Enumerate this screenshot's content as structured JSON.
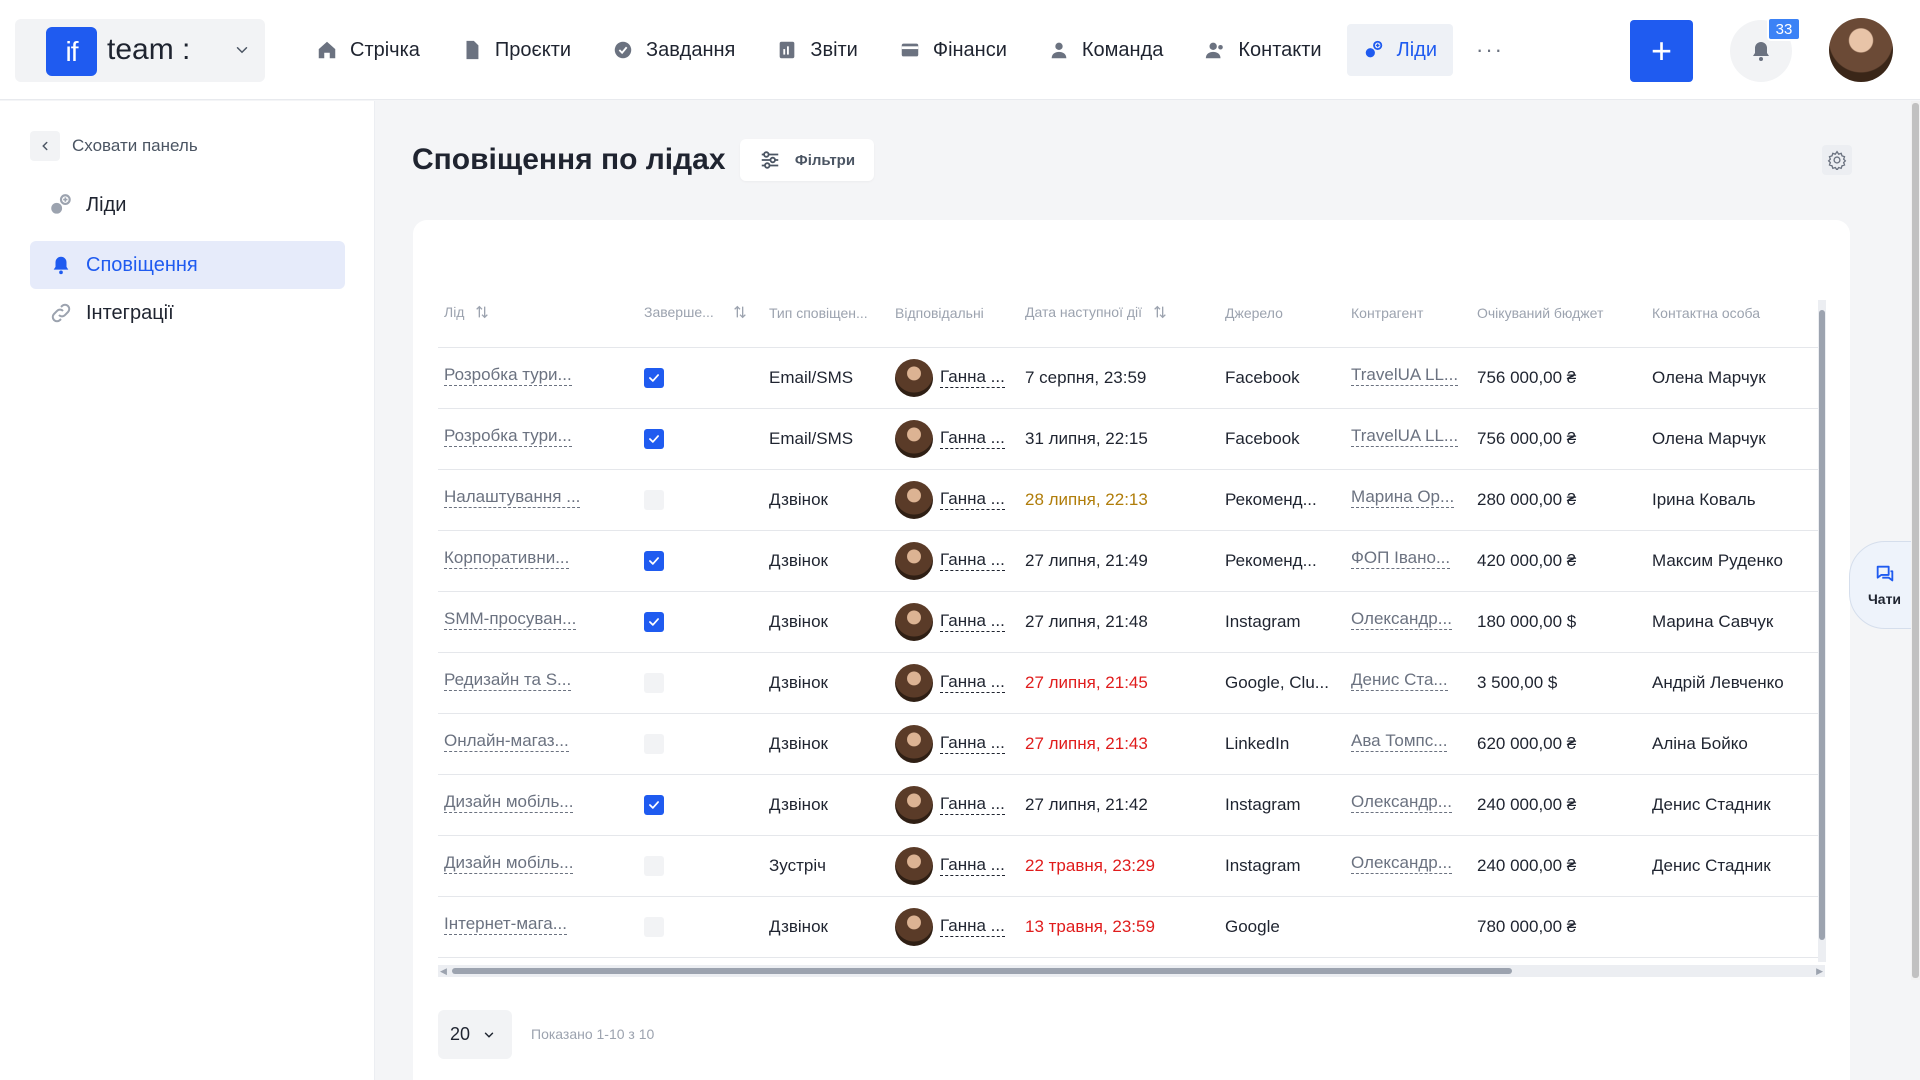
{
  "header": {
    "logo_text": "if",
    "team_name": "team :",
    "nav": [
      {
        "label": "Стрічка",
        "icon": "home-icon"
      },
      {
        "label": "Проєкти",
        "icon": "document-icon"
      },
      {
        "label": "Завдання",
        "icon": "check-circle-icon"
      },
      {
        "label": "Звіти",
        "icon": "report-icon"
      },
      {
        "label": "Фінанси",
        "icon": "wallet-icon"
      },
      {
        "label": "Команда",
        "icon": "person-icon"
      },
      {
        "label": "Контакти",
        "icon": "contacts-icon"
      },
      {
        "label": "Ліди",
        "icon": "leads-icon",
        "active": true
      }
    ],
    "more": "···",
    "add_label": "+",
    "notifications_count": "33"
  },
  "sidebar": {
    "hide_label": "Сховати панель",
    "items": [
      {
        "label": "Ліди",
        "icon": "leads-icon"
      },
      {
        "label": "Сповіщення",
        "icon": "bell-icon",
        "active": true
      },
      {
        "label": "Інтеграції",
        "icon": "link-icon"
      }
    ]
  },
  "main": {
    "title": "Сповіщення по лідах",
    "filters_label": "Фільтри"
  },
  "table": {
    "columns": [
      "Лід",
      "Заверше...",
      "Тип сповіщен...",
      "Відповідальні",
      "Дата наступної дії",
      "Джерело",
      "Контрагент",
      "Очікуваний бюджет",
      "Контактна особа"
    ],
    "rows": [
      {
        "lead": "Розробка тури...",
        "done": true,
        "type": "Email/SMS",
        "resp": "Ганна ...",
        "date": "7 серпня, 23:59",
        "date_status": "normal",
        "source": "Facebook",
        "counterparty": "TravelUA LL...",
        "budget": "756 000,00 ₴",
        "contact": "Олена Марчук"
      },
      {
        "lead": "Розробка тури...",
        "done": true,
        "type": "Email/SMS",
        "resp": "Ганна ...",
        "date": "31 липня, 22:15",
        "date_status": "normal",
        "source": "Facebook",
        "counterparty": "TravelUA LL...",
        "budget": "756 000,00 ₴",
        "contact": "Олена Марчук"
      },
      {
        "lead": "Налаштування ...",
        "done": false,
        "type": "Дзвінок",
        "resp": "Ганна ...",
        "date": "28 липня, 22:13",
        "date_status": "warn",
        "source": "Рекоменд...",
        "counterparty": "Марина Ор...",
        "budget": "280 000,00 ₴",
        "contact": "Ірина Коваль"
      },
      {
        "lead": "Корпоративни...",
        "done": true,
        "type": "Дзвінок",
        "resp": "Ганна ...",
        "date": "27 липня, 21:49",
        "date_status": "normal",
        "source": "Рекоменд...",
        "counterparty": "ФОП Івано...",
        "budget": "420 000,00 ₴",
        "contact": "Максим Руденко"
      },
      {
        "lead": "SMM-просуван...",
        "done": true,
        "type": "Дзвінок",
        "resp": "Ганна ...",
        "date": "27 липня, 21:48",
        "date_status": "normal",
        "source": "Instagram",
        "counterparty": "Олександр...",
        "budget": "180 000,00 $",
        "contact": "Марина Савчук"
      },
      {
        "lead": "Редизайн та S...",
        "done": false,
        "type": "Дзвінок",
        "resp": "Ганна ...",
        "date": "27 липня, 21:45",
        "date_status": "over",
        "source": "Google, Clu...",
        "counterparty": "Денис Ста...",
        "budget": "3 500,00 $",
        "contact": "Андрій Левченко"
      },
      {
        "lead": "Онлайн-магаз...",
        "done": false,
        "type": "Дзвінок",
        "resp": "Ганна ...",
        "date": "27 липня, 21:43",
        "date_status": "over",
        "source": "LinkedIn",
        "counterparty": "Ава Томпс...",
        "budget": "620 000,00 ₴",
        "contact": "Аліна Бойко"
      },
      {
        "lead": "Дизайн мобіль...",
        "done": true,
        "type": "Дзвінок",
        "resp": "Ганна ...",
        "date": "27 липня, 21:42",
        "date_status": "normal",
        "source": "Instagram",
        "counterparty": "Олександр...",
        "budget": "240 000,00 ₴",
        "contact": "Денис Стадник"
      },
      {
        "lead": "Дизайн мобіль...",
        "done": false,
        "type": "Зустріч",
        "resp": "Ганна ...",
        "date": "22 травня, 23:29",
        "date_status": "over",
        "source": "Instagram",
        "counterparty": "Олександр...",
        "budget": "240 000,00 ₴",
        "contact": "Денис Стадник"
      },
      {
        "lead": "Інтернет-мага...",
        "done": false,
        "type": "Дзвінок",
        "resp": "Ганна ...",
        "date": "13 травня, 23:59",
        "date_status": "over",
        "source": "Google",
        "counterparty": "",
        "budget": "780 000,00 ₴",
        "contact": ""
      }
    ]
  },
  "pagination": {
    "page_size": "20",
    "shown_text": "Показано 1-10 з 10"
  },
  "chats_label": "Чати",
  "colors": {
    "accent": "#1f5bf0",
    "warn": "#b07d0a",
    "overdue": "#e01c1c"
  }
}
